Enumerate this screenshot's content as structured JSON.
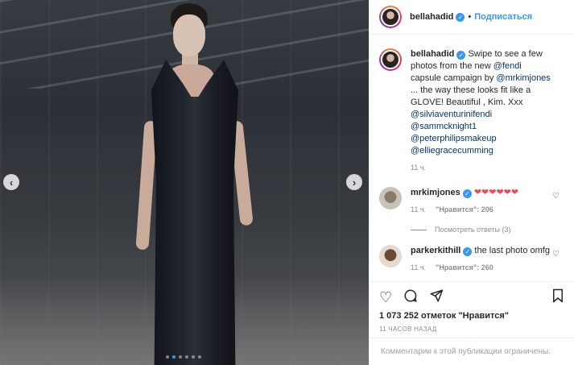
{
  "header": {
    "username": "bellahadid",
    "separator": "•",
    "follow_label": "Подписаться"
  },
  "caption": {
    "username": "bellahadid",
    "text_before": " Swipe to see a few photos from the new ",
    "mention1": "@fendi",
    "text_mid": " capsule campaign by ",
    "mention2": "@mrkimjones",
    "text_after": " ... the way these looks fit like a GLOVE! Beautiful , Kim. Xxx ",
    "mention3": "@silviaventurinifendi",
    "mention4": "@sammcknight1",
    "mention5": "@peterphilipsmakeup",
    "mention6": "@elliegracecumming",
    "time": "11 ч."
  },
  "comments": [
    {
      "username": "mrkimjones",
      "text": "❤❤❤❤❤❤",
      "time": "11 ч.",
      "likes": "\"Нравится\": 206",
      "replies": "Посмотреть ответы (3)"
    },
    {
      "username": "parkerkithill",
      "text": "the last photo omfg",
      "time": "11 ч.",
      "likes": "\"Нравится\": 260"
    }
  ],
  "actions": {
    "likes_count": "1 073 252 отметок \"Нравится\"",
    "time_ago": "11 ЧАСОВ НАЗАД"
  },
  "footer": {
    "text": "Комментарии к этой публикации ограничены."
  },
  "media": {
    "slides_total": 6,
    "active_slide": 2,
    "prev_arrow": "‹",
    "next_arrow": "›"
  },
  "colors": {
    "link": "#3897f0",
    "mention": "#00376b",
    "heart": "#ed4956"
  }
}
